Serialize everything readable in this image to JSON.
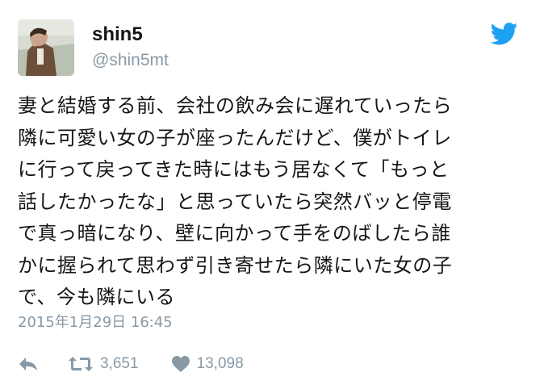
{
  "user": {
    "display_name": "shin5",
    "handle": "@shin5mt"
  },
  "tweet": {
    "text": "妻と結婚する前、会社の飲み会に遅れていったら\n隣に可愛い女の子が座ったんだけど、僕がトイレ\nに行って戻ってきた時にはもう居なくて「もっと\n話したかったな」と思っていたら突然バッと停電\nで真っ暗になり、壁に向かって手をのばしたら誰\nかに握られて思わず引き寄せたら隣にいた女の子\nで、今も隣にいる",
    "timestamp": "2015年1月29日 16:45"
  },
  "actions": {
    "retweet_count": "3,651",
    "like_count": "13,098"
  },
  "colors": {
    "text": "#14171a",
    "muted": "#8899a6",
    "twitter_blue": "#1da1f2"
  },
  "icons": {
    "logo": "twitter-bird-icon",
    "reply": "reply-icon",
    "retweet": "retweet-icon",
    "like": "heart-icon"
  }
}
